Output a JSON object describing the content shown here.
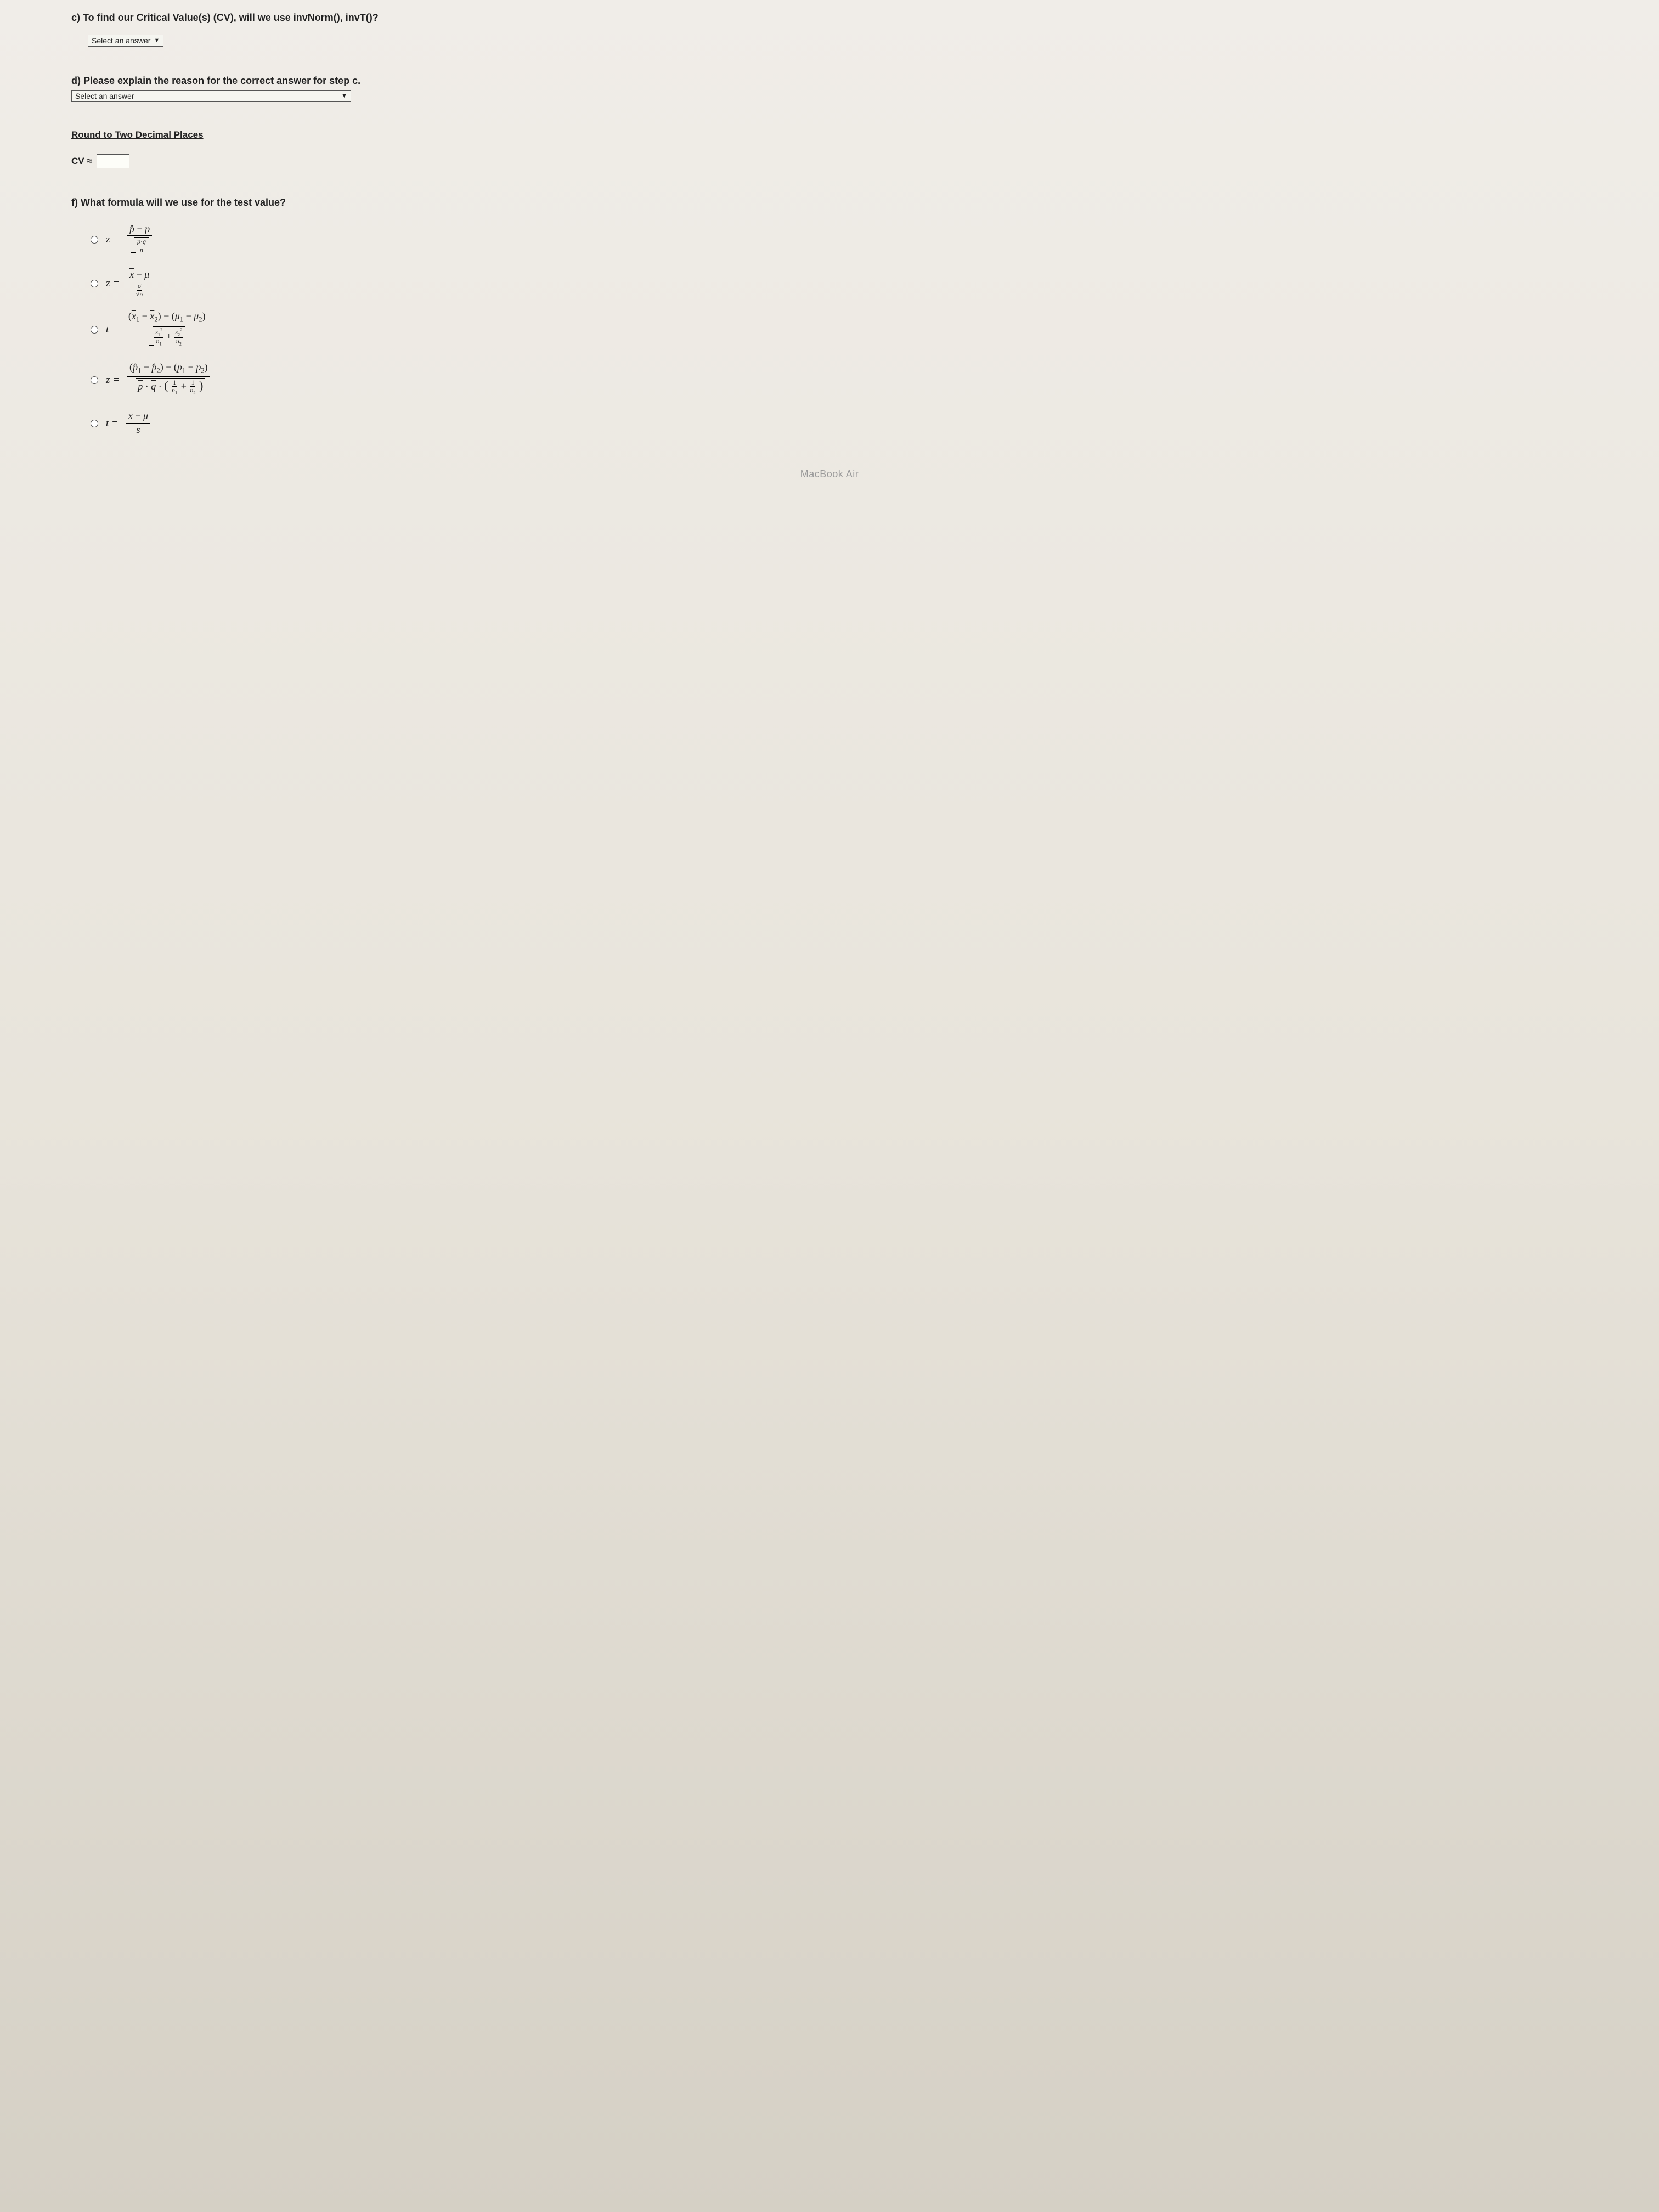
{
  "questions": {
    "c": {
      "text": "c) To find our Critical Value(s) (CV), will we use invNorm(), invT()?",
      "dropdown_placeholder": "Select an answer"
    },
    "d": {
      "text": "d) Please explain the reason for the correct answer for step c.",
      "dropdown_placeholder": "Select an answer"
    },
    "round_heading": "Round to Two Decimal Places",
    "cv_label": "CV ≈",
    "f": {
      "text": "f) What formula will we use for the test value?"
    }
  },
  "formula_options": [
    {
      "lhs": "z =",
      "type": "phat_over_pq_n"
    },
    {
      "lhs": "z =",
      "type": "xbar_mu_sigma"
    },
    {
      "lhs": "t =",
      "type": "two_mean_t"
    },
    {
      "lhs": "z =",
      "type": "two_prop_z"
    },
    {
      "lhs": "t =",
      "type": "xbar_mu_s"
    }
  ],
  "laptop_label": "MacBook Air"
}
